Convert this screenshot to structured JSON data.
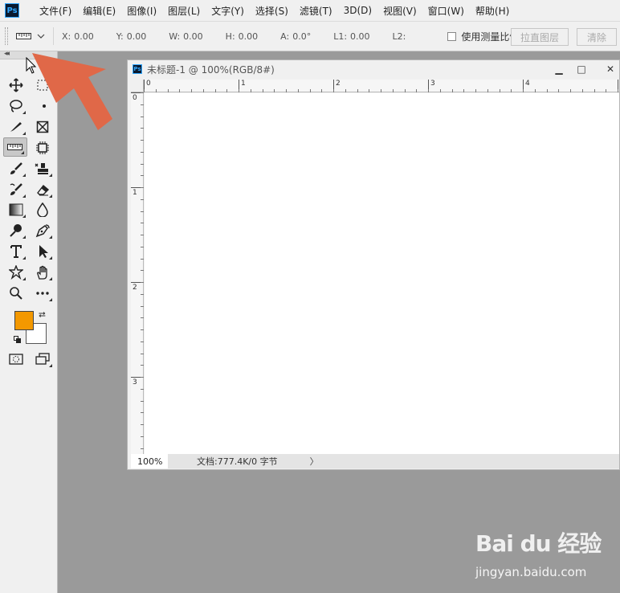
{
  "app": {
    "logo_text": "Ps"
  },
  "menu": [
    "文件(F)",
    "编辑(E)",
    "图像(I)",
    "图层(L)",
    "文字(Y)",
    "选择(S)",
    "滤镜(T)",
    "3D(D)",
    "视图(V)",
    "窗口(W)",
    "帮助(H)"
  ],
  "options": {
    "tool_icon": "ruler-icon",
    "fields": [
      {
        "label": "X:",
        "value": "0.00"
      },
      {
        "label": "Y:",
        "value": "0.00"
      },
      {
        "label": "W:",
        "value": "0.00"
      },
      {
        "label": "H:",
        "value": "0.00"
      },
      {
        "label": "A:",
        "value": "0.0°"
      },
      {
        "label": "L1:",
        "value": "0.00"
      },
      {
        "label": "L2:",
        "value": ""
      }
    ],
    "use_scale_label": "使用测量比例",
    "straighten_label": "拉直图层",
    "clear_label": "清除"
  },
  "colors": {
    "foreground": "#f39800",
    "background": "#ffffff",
    "annotation_arrow": "#e06848"
  },
  "document": {
    "icon_text": "Ps",
    "title": "未标题-1 @ 100%(RGB/8#)",
    "ruler_top": [
      "0",
      "1",
      "2",
      "3",
      "4"
    ],
    "ruler_left": [
      "0",
      "1",
      "2",
      "3"
    ],
    "zoom": "100%",
    "info": "文档:777.4K/0 字节",
    "info_arrow": "〉",
    "win_minimize": "▁",
    "win_maximize": "□",
    "win_close": "✕"
  },
  "watermark": {
    "logo": "Bai du 经验",
    "url": "jingyan.baidu.com"
  }
}
